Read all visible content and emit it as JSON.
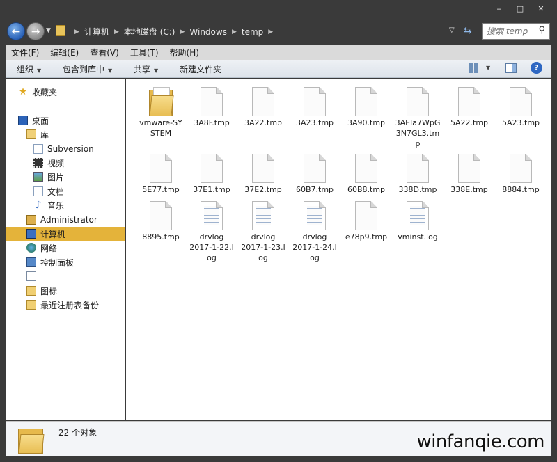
{
  "window": {
    "minimize": "‒",
    "maximize": "□",
    "close": "✕"
  },
  "address": {
    "crumbs": [
      "计算机",
      "本地磁盘 (C:)",
      "Windows",
      "temp"
    ],
    "search_placeholder": "搜索 temp"
  },
  "menu": [
    "文件(F)",
    "编辑(E)",
    "查看(V)",
    "工具(T)",
    "帮助(H)"
  ],
  "toolbar": {
    "organize": "组织",
    "include_library": "包含到库中",
    "share": "共享",
    "new_folder": "新建文件夹"
  },
  "nav": {
    "favorites": "收藏夹",
    "desktop": "桌面",
    "library": "库",
    "subversion": "Subversion",
    "video": "视频",
    "pictures": "图片",
    "documents": "文档",
    "music": "音乐",
    "administrator": "Administrator",
    "computer": "计算机",
    "network": "网络",
    "control_panel": "控制面板",
    "recycle": "",
    "icons": "图标",
    "registry_backup": "最近注册表备份"
  },
  "files": [
    {
      "name": "vmware-SYSTEM",
      "line1": "vmware-SY",
      "line2": "STEM",
      "line3": "",
      "type": "folder"
    },
    {
      "name": "3A8F.tmp",
      "line1": "3A8F.tmp",
      "line2": "",
      "line3": "",
      "type": "tmp"
    },
    {
      "name": "3A22.tmp",
      "line1": "3A22.tmp",
      "line2": "",
      "line3": "",
      "type": "tmp"
    },
    {
      "name": "3A23.tmp",
      "line1": "3A23.tmp",
      "line2": "",
      "line3": "",
      "type": "tmp"
    },
    {
      "name": "3A90.tmp",
      "line1": "3A90.tmp",
      "line2": "",
      "line3": "",
      "type": "tmp"
    },
    {
      "name": "3AEIa7WpG3N7GL3.tmp",
      "line1": "3AEIa7WpG",
      "line2": "3N7GL3.tm",
      "line3": "p",
      "type": "tmp"
    },
    {
      "name": "5A22.tmp",
      "line1": "5A22.tmp",
      "line2": "",
      "line3": "",
      "type": "tmp"
    },
    {
      "name": "5A23.tmp",
      "line1": "5A23.tmp",
      "line2": "",
      "line3": "",
      "type": "tmp"
    },
    {
      "name": "5E77.tmp",
      "line1": "5E77.tmp",
      "line2": "",
      "line3": "",
      "type": "tmp"
    },
    {
      "name": "37E1.tmp",
      "line1": "37E1.tmp",
      "line2": "",
      "line3": "",
      "type": "tmp"
    },
    {
      "name": "37E2.tmp",
      "line1": "37E2.tmp",
      "line2": "",
      "line3": "",
      "type": "tmp"
    },
    {
      "name": "60B7.tmp",
      "line1": "60B7.tmp",
      "line2": "",
      "line3": "",
      "type": "tmp"
    },
    {
      "name": "60B8.tmp",
      "line1": "60B8.tmp",
      "line2": "",
      "line3": "",
      "type": "tmp"
    },
    {
      "name": "338D.tmp",
      "line1": "338D.tmp",
      "line2": "",
      "line3": "",
      "type": "tmp"
    },
    {
      "name": "338E.tmp",
      "line1": "338E.tmp",
      "line2": "",
      "line3": "",
      "type": "tmp"
    },
    {
      "name": "8884.tmp",
      "line1": "8884.tmp",
      "line2": "",
      "line3": "",
      "type": "tmp"
    },
    {
      "name": "8895.tmp",
      "line1": "8895.tmp",
      "line2": "",
      "line3": "",
      "type": "tmp"
    },
    {
      "name": "drvlog 2017-1-22.log",
      "line1": "drvlog",
      "line2": "2017-1-22.l",
      "line3": "og",
      "type": "log"
    },
    {
      "name": "drvlog 2017-1-23.log",
      "line1": "drvlog",
      "line2": "2017-1-23.l",
      "line3": "og",
      "type": "log"
    },
    {
      "name": "drvlog 2017-1-24.log",
      "line1": "drvlog",
      "line2": "2017-1-24.l",
      "line3": "og",
      "type": "log"
    },
    {
      "name": "e78p9.tmp",
      "line1": "e78p9.tmp",
      "line2": "",
      "line3": "",
      "type": "tmp"
    },
    {
      "name": "vminst.log",
      "line1": "vminst.log",
      "line2": "",
      "line3": "",
      "type": "log"
    }
  ],
  "status": {
    "count": "22 个对象"
  },
  "watermark": "winfanqie.com"
}
